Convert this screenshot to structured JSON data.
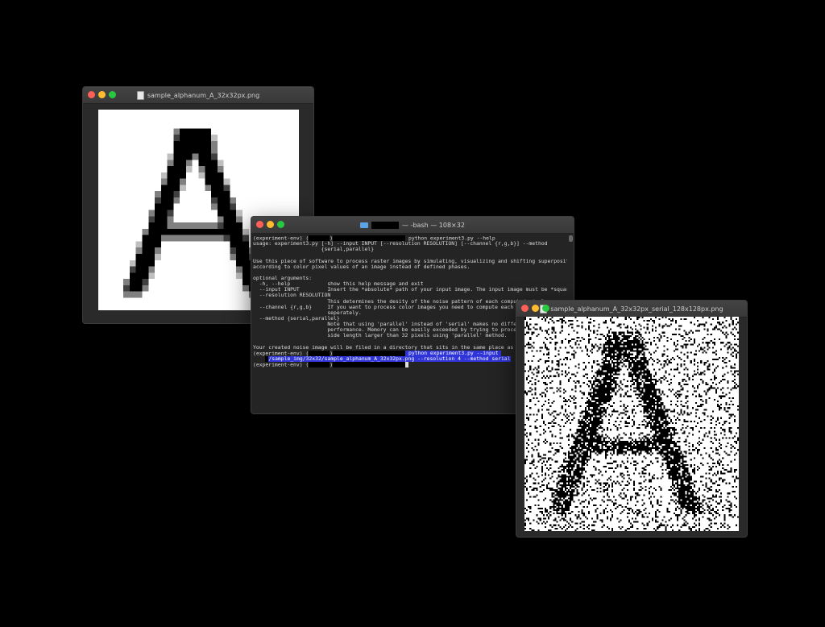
{
  "window1": {
    "title": "sample_alphanum_A_32x32px.png"
  },
  "terminal": {
    "title_suffix": "— -bash — 108×32",
    "lines": [
      {
        "parts": [
          {
            "t": "(experiment-env) ("
          },
          {
            "redact": 26
          },
          {
            "t": ")"
          },
          {
            "redact": 90
          },
          {
            "t": " python experiment3.py --help"
          }
        ]
      },
      {
        "parts": [
          {
            "t": "usage: experiment3.py [-h] --input INPUT [--resolution RESOLUTION] [--channel {r,g,b}] --method"
          }
        ]
      },
      {
        "parts": [
          {
            "t": "                      {serial,parallel}"
          }
        ]
      },
      {
        "parts": [
          {
            "t": ""
          }
        ]
      },
      {
        "parts": [
          {
            "t": "Use this piece of software to process raster images by simulating, visualizing and shifting superposition"
          }
        ]
      },
      {
        "parts": [
          {
            "t": "according to color pixel values of an image instead of defined phases."
          }
        ]
      },
      {
        "parts": [
          {
            "t": ""
          }
        ]
      },
      {
        "parts": [
          {
            "t": "optional arguments:"
          }
        ]
      },
      {
        "parts": [
          {
            "t": "  -h, --help            show this help message and exit"
          }
        ]
      },
      {
        "parts": [
          {
            "t": "  --input INPUT         Insert the *absolute* path of your input image. The input image must be *squared*!"
          }
        ]
      },
      {
        "parts": [
          {
            "t": "  --resolution RESOLUTION"
          }
        ]
      },
      {
        "parts": [
          {
            "t": "                        This determines the desity of the noise pattern of each computed pixel."
          }
        ]
      },
      {
        "parts": [
          {
            "t": "  --channel {r,g,b}     If you want to process color images you need to compute each color channel (rgb)"
          }
        ]
      },
      {
        "parts": [
          {
            "t": "                        seperately."
          }
        ]
      },
      {
        "parts": [
          {
            "t": "  --method {serial,parallel}"
          }
        ]
      },
      {
        "parts": [
          {
            "t": "                        Note that using 'parallel' instead of 'serial' makes no difference"
          }
        ]
      },
      {
        "parts": [
          {
            "t": "                        performance. Memory can be easily exceeded by trying to process an"
          }
        ]
      },
      {
        "parts": [
          {
            "t": "                        side length larger than 32 pixels using 'parallel' method."
          }
        ]
      },
      {
        "parts": [
          {
            "t": ""
          }
        ]
      },
      {
        "parts": [
          {
            "t": "Your created noise image will be filed in a directory that sits in the same place as this p"
          }
        ]
      },
      {
        "parts": [
          {
            "t": "(experiment-env) ("
          },
          {
            "redact": 26
          },
          {
            "t": ")"
          },
          {
            "redact": 90
          },
          {
            "t": " python experiment3.py --input ",
            "hl": true
          }
        ]
      },
      {
        "parts": [
          {
            "t": "    "
          },
          {
            "redact": 4
          },
          {
            "t": "/sample_img/32x32/sample_alphanum_A_32x32px.png --resolution 4 --method serial",
            "hl": true
          }
        ]
      },
      {
        "parts": [
          {
            "t": "(experiment-env) ("
          },
          {
            "redact": 26
          },
          {
            "t": ")"
          },
          {
            "redact": 90
          },
          {
            "cursor": true
          }
        ]
      }
    ]
  },
  "window3": {
    "title": "sample_alphanum_A_32x32px_serial_128x128px.png"
  }
}
